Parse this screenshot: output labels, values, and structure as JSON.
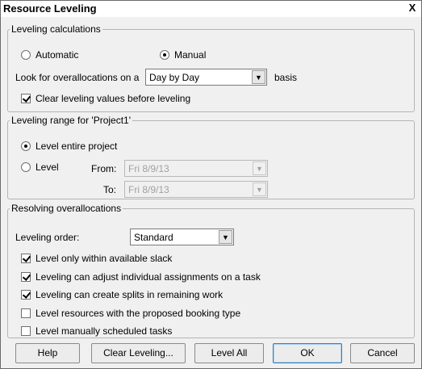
{
  "window": {
    "title": "Resource Leveling",
    "close_glyph": "X"
  },
  "calc": {
    "legend": "Leveling calculations",
    "automatic_label": "Automatic",
    "manual_label": "Manual",
    "selected": "Manual",
    "overalloc_prefix": "Look for overallocations on a",
    "overalloc_value": "Day by Day",
    "overalloc_suffix": "basis",
    "clear_label": "Clear leveling values before leveling",
    "clear_checked": true
  },
  "range": {
    "legend": "Leveling range for 'Project1'",
    "entire_label": "Level entire project",
    "level_label": "Level",
    "selected": "Level entire project",
    "from_label": "From:",
    "from_value": "Fri 8/9/13",
    "to_label": "To:",
    "to_value": "Fri 8/9/13"
  },
  "resolve": {
    "legend": "Resolving overallocations",
    "order_label": "Leveling order:",
    "order_value": "Standard",
    "options": [
      {
        "label": "Level only within available slack",
        "checked": true
      },
      {
        "label": "Leveling can adjust individual assignments on a task",
        "checked": true
      },
      {
        "label": "Leveling can create splits in remaining work",
        "checked": true
      },
      {
        "label": "Level resources with the proposed booking type",
        "checked": false
      },
      {
        "label": "Level manually scheduled tasks",
        "checked": false
      }
    ]
  },
  "buttons": {
    "help": "Help",
    "clear_leveling": "Clear Leveling...",
    "level_all": "Level All",
    "ok": "OK",
    "cancel": "Cancel"
  },
  "icons": {
    "dropdown": "chevron-down-icon"
  }
}
